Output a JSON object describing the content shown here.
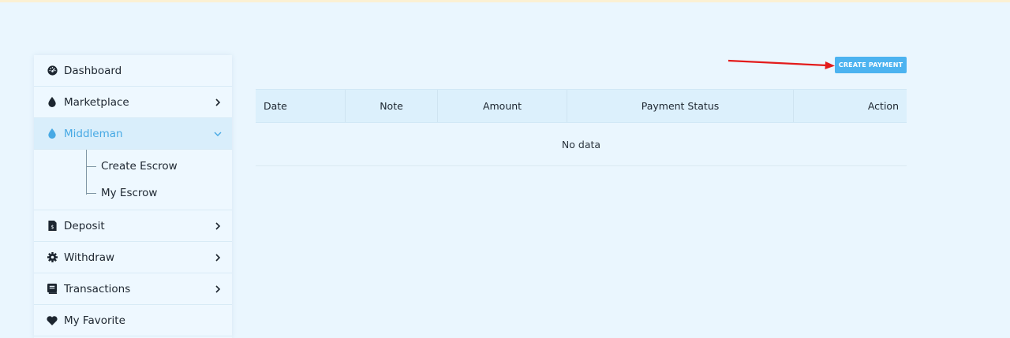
{
  "sidebar": {
    "items": [
      {
        "label": "Dashboard",
        "icon": "dashboard-icon"
      },
      {
        "label": "Marketplace",
        "icon": "droplet-icon"
      },
      {
        "label": "Middleman",
        "icon": "droplet-icon",
        "active": true
      },
      {
        "label": "Deposit",
        "icon": "receipt-icon"
      },
      {
        "label": "Withdraw",
        "icon": "gear-icon"
      },
      {
        "label": "Transactions",
        "icon": "book-icon"
      },
      {
        "label": "My Favorite",
        "icon": "heart-icon"
      }
    ],
    "submenu": [
      {
        "label": "Create Escrow"
      },
      {
        "label": "My Escrow"
      }
    ]
  },
  "toolbar": {
    "create_payment_label": "CREATE PAYMENT"
  },
  "table": {
    "columns": [
      "Date",
      "Note",
      "Amount",
      "Payment Status",
      "Action"
    ],
    "empty_text": "No data"
  },
  "colors": {
    "page_bg": "#eaf6fe",
    "accent": "#4cb3f0",
    "active_text": "#47a9e4",
    "annotation_arrow": "#e31b1b"
  }
}
